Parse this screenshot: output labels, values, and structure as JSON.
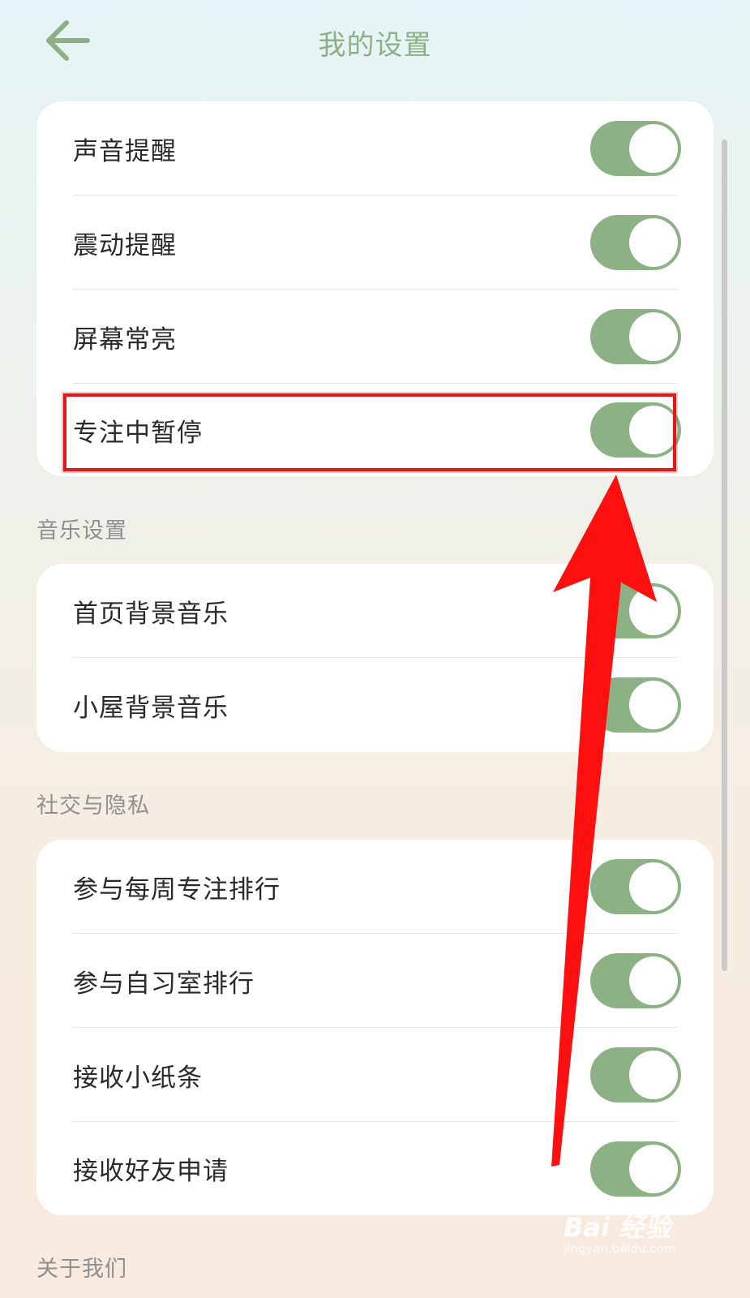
{
  "header": {
    "title": "我的设置",
    "back_icon": "arrow-left-icon"
  },
  "colors": {
    "accent": "#8bb184",
    "title": "#8fae86",
    "highlight": "#e01818",
    "arrow": "#ff1010"
  },
  "general_settings": [
    {
      "label": "声音提醒",
      "enabled": true
    },
    {
      "label": "震动提醒",
      "enabled": true
    },
    {
      "label": "屏幕常亮",
      "enabled": true
    },
    {
      "label": "专注中暂停",
      "enabled": true
    }
  ],
  "music_section": {
    "title": "音乐设置",
    "items": [
      {
        "label": "首页背景音乐",
        "enabled": true
      },
      {
        "label": "小屋背景音乐",
        "enabled": true
      }
    ]
  },
  "social_section": {
    "title": "社交与隐私",
    "items": [
      {
        "label": "参与每周专注排行",
        "enabled": true
      },
      {
        "label": "参与自习室排行",
        "enabled": true
      },
      {
        "label": "接收小纸条",
        "enabled": true
      },
      {
        "label": "接收好友申请",
        "enabled": true
      }
    ]
  },
  "about_section": {
    "title": "关于我们"
  },
  "watermark": {
    "main": "Bai 经验",
    "sub": "jingyan.baidu.com"
  }
}
